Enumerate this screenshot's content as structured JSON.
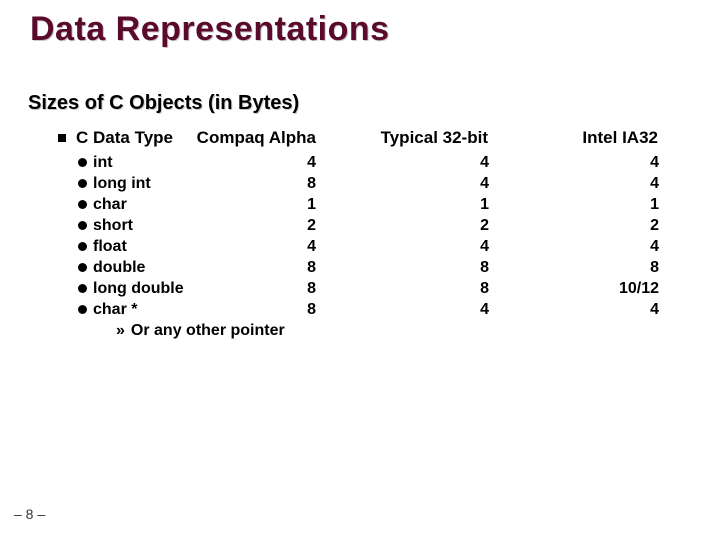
{
  "title": "Data Representations",
  "subtitle": "Sizes of C Objects (in Bytes)",
  "header": {
    "type": "C Data Type",
    "alpha": "Compaq Alpha",
    "t32": "Typical 32-bit",
    "ia32": "Intel IA32"
  },
  "rows": [
    {
      "name": "int",
      "alpha": "4",
      "t32": "4",
      "ia32": "4"
    },
    {
      "name": "long int",
      "alpha": "8",
      "t32": "4",
      "ia32": "4"
    },
    {
      "name": "char",
      "alpha": "1",
      "t32": "1",
      "ia32": "1"
    },
    {
      "name": "short",
      "alpha": "2",
      "t32": "2",
      "ia32": "2"
    },
    {
      "name": "float",
      "alpha": "4",
      "t32": "4",
      "ia32": "4"
    },
    {
      "name": "double",
      "alpha": "8",
      "t32": "8",
      "ia32": "8"
    },
    {
      "name": "long double",
      "alpha": "8",
      "t32": "8",
      "ia32": "10/12"
    },
    {
      "name": "char *",
      "alpha": "8",
      "t32": "4",
      "ia32": "4"
    }
  ],
  "footnote": "Or any other pointer",
  "page": "– 8 –",
  "chart_data": {
    "type": "table",
    "title": "Sizes of C Objects (in Bytes)",
    "columns": [
      "C Data Type",
      "Compaq Alpha",
      "Typical 32-bit",
      "Intel IA32"
    ],
    "rows": [
      [
        "int",
        4,
        4,
        4
      ],
      [
        "long int",
        8,
        4,
        4
      ],
      [
        "char",
        1,
        1,
        1
      ],
      [
        "short",
        2,
        2,
        2
      ],
      [
        "float",
        4,
        4,
        4
      ],
      [
        "double",
        8,
        8,
        8
      ],
      [
        "long double",
        8,
        8,
        "10/12"
      ],
      [
        "char *",
        8,
        4,
        4
      ]
    ]
  }
}
